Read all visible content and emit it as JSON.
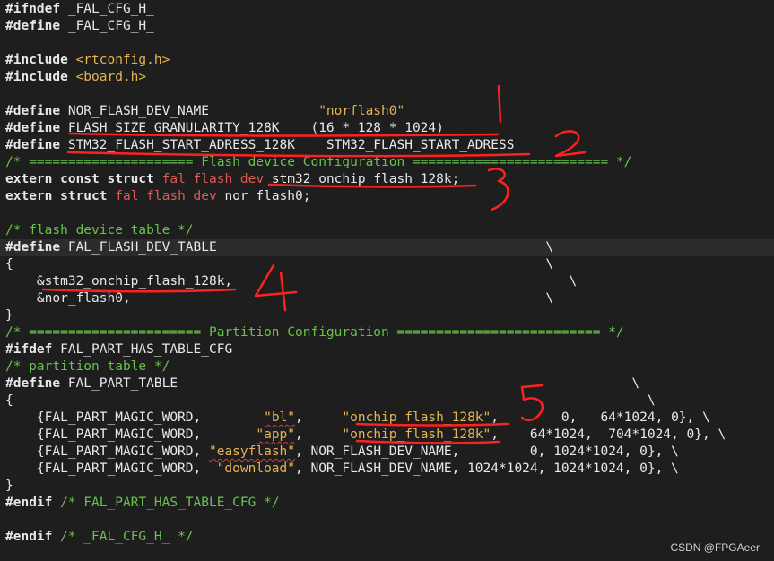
{
  "code_lines": [
    [
      {
        "c": "kw",
        "t": "#ifndef"
      },
      {
        "c": "pln",
        "t": " _FAL_CFG_H_"
      }
    ],
    [
      {
        "c": "kw",
        "t": "#define"
      },
      {
        "c": "pln",
        "t": " _FAL_CFG_H_"
      }
    ],
    [],
    [
      {
        "c": "kw",
        "t": "#include"
      },
      {
        "c": "pln",
        "t": " "
      },
      {
        "c": "str",
        "t": "<rtconfig.h>"
      }
    ],
    [
      {
        "c": "kw",
        "t": "#include"
      },
      {
        "c": "pln",
        "t": " "
      },
      {
        "c": "str",
        "t": "<board.h>"
      }
    ],
    [],
    [
      {
        "c": "kw",
        "t": "#define"
      },
      {
        "c": "pln",
        "t": " NOR_FLASH_DEV_NAME              "
      },
      {
        "c": "str",
        "t": "\"norflash0\""
      }
    ],
    [
      {
        "c": "kw",
        "t": "#define"
      },
      {
        "c": "pln",
        "t": " FLASH_SIZE_GRANULARITY_128K    (16 * 128 * 1024)"
      }
    ],
    [
      {
        "c": "kw",
        "t": "#define"
      },
      {
        "c": "pln",
        "t": " STM32_FLASH_START_ADRESS_128K    STM32_FLASH_START_ADRESS"
      }
    ],
    [
      {
        "c": "cmt",
        "t": "/* ===================== Flash device Configuration ========================= */"
      }
    ],
    [
      {
        "c": "kw",
        "t": "extern const struct"
      },
      {
        "c": "pln",
        "t": " "
      },
      {
        "c": "typ",
        "t": "fal_flash_dev"
      },
      {
        "c": "pln",
        "t": " stm32_onchip_flash_128k;"
      }
    ],
    [
      {
        "c": "kw",
        "t": "extern struct"
      },
      {
        "c": "pln",
        "t": " "
      },
      {
        "c": "typ",
        "t": "fal_flash_dev"
      },
      {
        "c": "pln",
        "t": " nor_flash0;"
      }
    ],
    [],
    [
      {
        "c": "cmt",
        "t": "/* flash device table */"
      }
    ],
    [
      {
        "c": "kw",
        "t": "#define"
      },
      {
        "c": "pln",
        "t": " FAL_FLASH_DEV_TABLE                                          \\"
      }
    ],
    [
      {
        "c": "pln",
        "t": "{                                                                    \\"
      }
    ],
    [
      {
        "c": "pln",
        "t": "    &stm32_onchip_flash_128k,                                           \\"
      }
    ],
    [
      {
        "c": "pln",
        "t": "    &nor_flash0,                                                     \\"
      }
    ],
    [
      {
        "c": "pln",
        "t": "}"
      }
    ],
    [
      {
        "c": "cmt",
        "t": "/* ====================== Partition Configuration ========================== */"
      }
    ],
    [
      {
        "c": "kw",
        "t": "#ifdef"
      },
      {
        "c": "pln",
        "t": " FAL_PART_HAS_TABLE_CFG"
      }
    ],
    [
      {
        "c": "cmt",
        "t": "/* partition table */"
      }
    ],
    [
      {
        "c": "kw",
        "t": "#define"
      },
      {
        "c": "pln",
        "t": " FAL_PART_TABLE                                                          \\"
      }
    ],
    [
      {
        "c": "pln",
        "t": "{                                                                                 \\"
      }
    ],
    [
      {
        "c": "pln",
        "t": "    {FAL_PART_MAGIC_WORD,        "
      },
      {
        "c": "str sq",
        "t": "\"bl\""
      },
      {
        "c": "pln",
        "t": ",     "
      },
      {
        "c": "str",
        "t": "\"onchip_flash_128k\""
      },
      {
        "c": "pln",
        "t": ",        0,   64*1024, 0}, \\"
      }
    ],
    [
      {
        "c": "pln",
        "t": "    {FAL_PART_MAGIC_WORD,       "
      },
      {
        "c": "str sq",
        "t": "\"app\""
      },
      {
        "c": "pln",
        "t": ",     "
      },
      {
        "c": "str",
        "t": "\"onchip_flash_128k\""
      },
      {
        "c": "pln",
        "t": ",    64*1024,  704*1024, 0}, \\"
      }
    ],
    [
      {
        "c": "pln",
        "t": "    {FAL_PART_MAGIC_WORD, "
      },
      {
        "c": "str sq",
        "t": "\"easyflash\""
      },
      {
        "c": "pln",
        "t": ", NOR_FLASH_DEV_NAME,         0, 1024*1024, 0}, \\"
      }
    ],
    [
      {
        "c": "pln",
        "t": "    {FAL_PART_MAGIC_WORD,  "
      },
      {
        "c": "str",
        "t": "\"download\""
      },
      {
        "c": "pln",
        "t": ", NOR_FLASH_DEV_NAME, 1024*1024, 1024*1024, 0}, \\"
      }
    ],
    [
      {
        "c": "pln",
        "t": "}"
      }
    ],
    [
      {
        "c": "kw",
        "t": "#endif"
      },
      {
        "c": "pln",
        "t": " "
      },
      {
        "c": "cmt",
        "t": "/* FAL_PART_HAS_TABLE_CFG */"
      }
    ],
    [],
    [
      {
        "c": "kw",
        "t": "#endif"
      },
      {
        "c": "pln",
        "t": " "
      },
      {
        "c": "cmt",
        "t": "/* _FAL_CFG_H_ */"
      }
    ]
  ],
  "highlighted_lines": [
    14
  ],
  "annotations": {
    "color": "#ff2020",
    "labels": [
      "1",
      "2",
      "3",
      "4",
      "5"
    ]
  },
  "watermark": "CSDN @FPGAeer"
}
